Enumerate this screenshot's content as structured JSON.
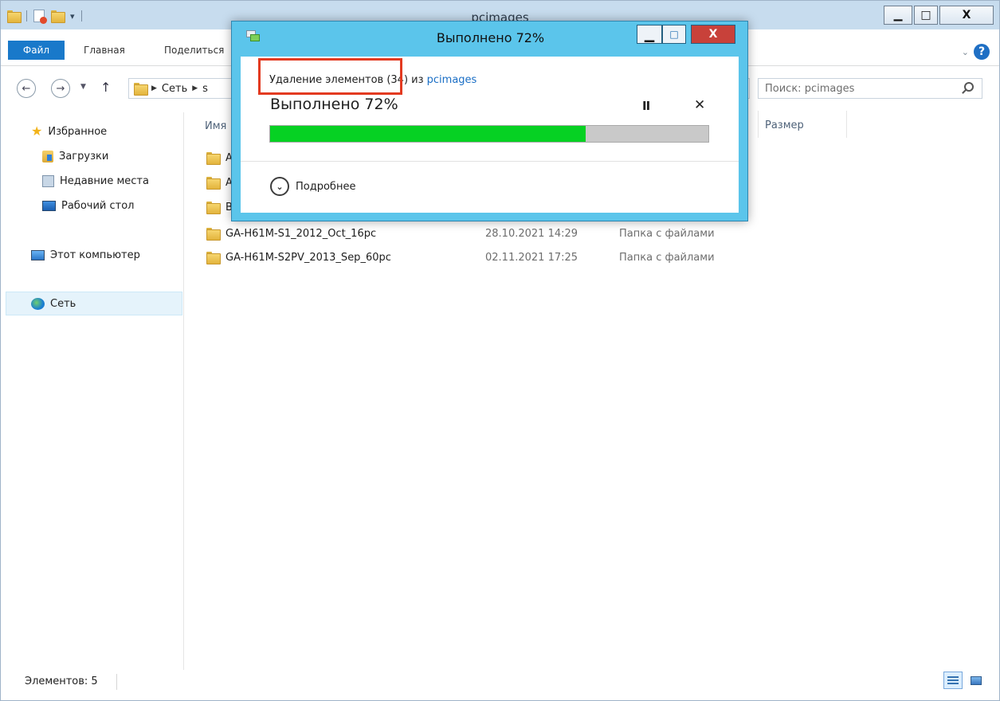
{
  "explorer": {
    "title": "pcimages",
    "ribbon_tabs": [
      "Файл",
      "Главная",
      "Поделиться"
    ],
    "address": {
      "crumbs": [
        "Сеть",
        "s"
      ]
    },
    "search": {
      "placeholder": "Поиск: pcimages"
    },
    "columns": {
      "name": "Имя",
      "size": "Размер"
    },
    "navpane": {
      "favorites": "Избранное",
      "downloads": "Загрузки",
      "recent": "Недавние места",
      "desktop": "Рабочий стол",
      "computer": "Этот компьютер",
      "network": "Сеть"
    },
    "files": [
      {
        "name": "A",
        "date": "",
        "type": ""
      },
      {
        "name": "A",
        "date": "",
        "type": ""
      },
      {
        "name": "B",
        "date": "",
        "type": ""
      },
      {
        "name": "GA-H61M-S1_2012_Oct_16pc",
        "date": "28.10.2021 14:29",
        "type": "Папка с файлами"
      },
      {
        "name": "GA-H61M-S2PV_2013_Sep_60pc",
        "date": "02.11.2021 17:25",
        "type": "Папка с файлами"
      }
    ],
    "status": {
      "count": "Элементов: 5"
    },
    "controls": {
      "minimize": "▁",
      "maximize": "□",
      "close": "X"
    }
  },
  "dialog": {
    "title": "Выполнено 72%",
    "desc_action": "Удаление элементов",
    "desc_count": " (34) из ",
    "desc_link": "pcimages",
    "percent_label": "Выполнено 72%",
    "progress_percent": 72,
    "pause": "II",
    "cancel": "✕",
    "more_details": "Подробнее"
  },
  "colors": {
    "progress": "#06d123",
    "dialog_frame": "#5bc5eb",
    "highlight": "#e33a20",
    "file_tab": "#1979ca",
    "link": "#1a6ec5"
  }
}
